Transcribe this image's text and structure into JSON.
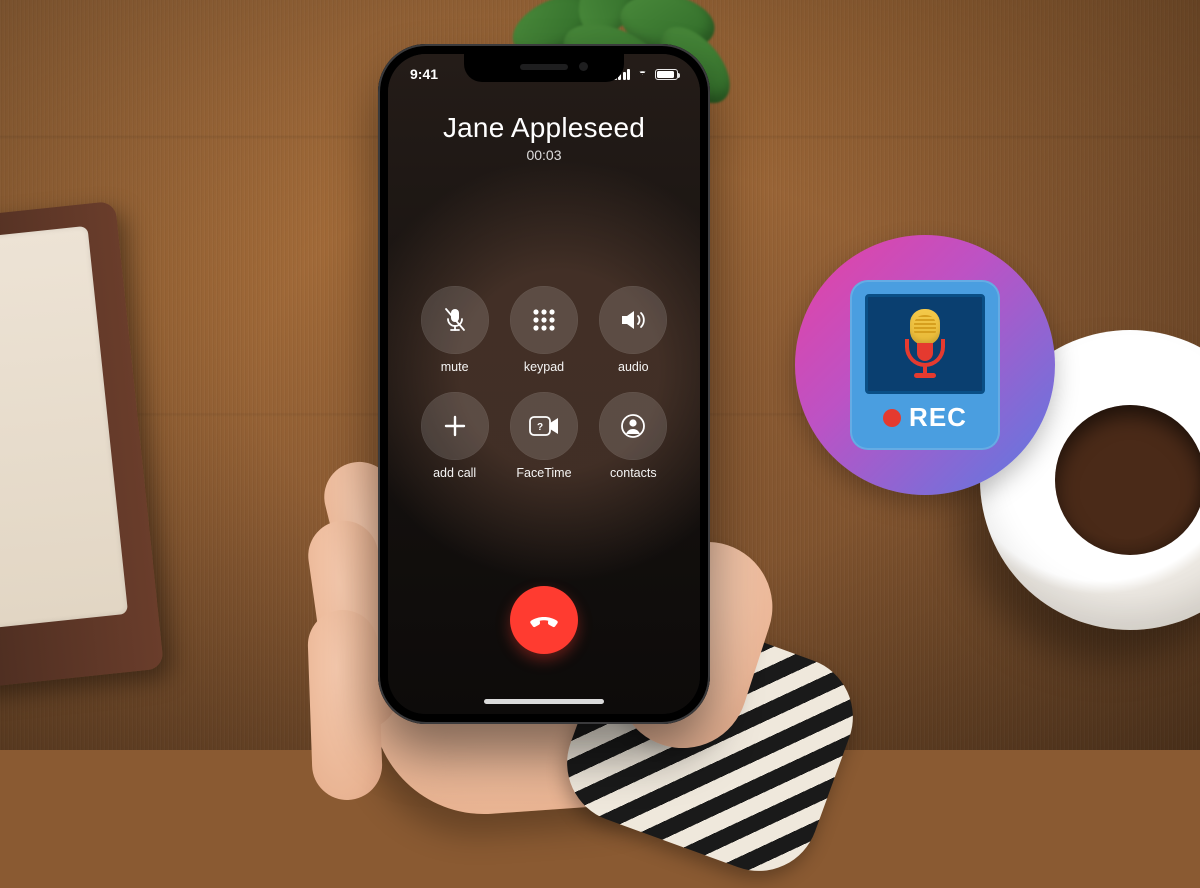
{
  "status": {
    "time": "9:41"
  },
  "call": {
    "name": "Jane Appleseed",
    "duration": "00:03"
  },
  "controls": {
    "mute": {
      "label": "mute"
    },
    "keypad": {
      "label": "keypad"
    },
    "audio": {
      "label": "audio"
    },
    "add_call": {
      "label": "add call"
    },
    "facetime": {
      "label": "FaceTime"
    },
    "contacts": {
      "label": "contacts"
    }
  },
  "badge": {
    "rec_label": "REC"
  }
}
